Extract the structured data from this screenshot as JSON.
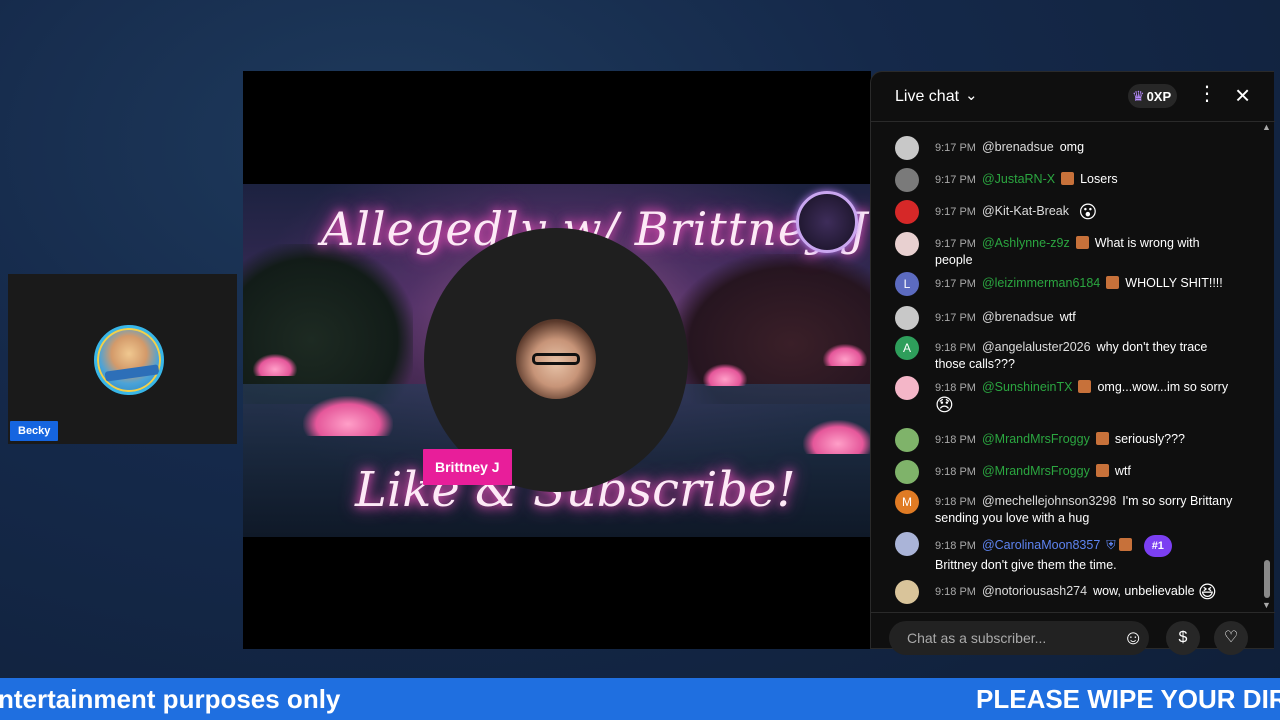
{
  "guest": {
    "name": "Becky"
  },
  "host": {
    "name": "Brittney J"
  },
  "banner": {
    "title": "Allegedly w/ Brittney J",
    "subtitle": "Like & Subscribe!"
  },
  "chat": {
    "title": "Live chat",
    "xp": "0XP",
    "input_placeholder": "Chat as a subscriber...",
    "messages": [
      {
        "time": "9:17 PM",
        "author": "@brenadsue",
        "text": "omg",
        "author_type": "normal",
        "avatar": "#c8c8c8"
      },
      {
        "time": "9:17 PM",
        "author": "@JustaRN-X",
        "text": "Losers",
        "author_type": "member",
        "avatar": "#7a7a7a"
      },
      {
        "time": "9:17 PM",
        "author": "@Kit-Kat-Break",
        "text": "",
        "author_type": "normal",
        "avatar": "#d62828",
        "emoji": "😮"
      },
      {
        "time": "9:17 PM",
        "author": "@Ashlynne-z9z",
        "text": "What is wrong with people",
        "author_type": "member",
        "avatar": "#e8d0d0"
      },
      {
        "time": "9:17 PM",
        "author": "@leizimmerman6184",
        "text": "WHOLLY SHIT!!!!",
        "author_type": "member",
        "avatar": "#5c6bc0",
        "initial": "L"
      },
      {
        "time": "9:17 PM",
        "author": "@brenadsue",
        "text": "wtf",
        "author_type": "normal",
        "avatar": "#c8c8c8"
      },
      {
        "time": "9:18 PM",
        "author": "@angelaluster2026",
        "text": "why don't they trace those calls???",
        "author_type": "normal",
        "avatar": "#2e9e5b",
        "initial": "A"
      },
      {
        "time": "9:18 PM",
        "author": "@SunshineinTX",
        "text": "omg...wow...im so sorry",
        "author_type": "member",
        "avatar": "#f4b6c8",
        "emoji": "😞"
      },
      {
        "time": "9:18 PM",
        "author": "@MrandMrsFroggy",
        "text": "seriously???",
        "author_type": "member",
        "avatar": "#7fb36a"
      },
      {
        "time": "9:18 PM",
        "author": "@MrandMrsFroggy",
        "text": "wtf",
        "author_type": "member",
        "avatar": "#7fb36a"
      },
      {
        "time": "9:18 PM",
        "author": "@mechellejohnson3298",
        "text": "I'm so sorry Brittany sending you love with a hug",
        "author_type": "normal",
        "avatar": "#e07b24",
        "initial": "M"
      },
      {
        "time": "9:18 PM",
        "author": "@CarolinaMoon8357",
        "text": "Brittney don't give them the time.",
        "author_type": "mod",
        "avatar": "#aab4d8",
        "rank": "#1"
      },
      {
        "time": "9:18 PM",
        "author": "@notoriousash274",
        "text": "wow, unbelievable",
        "author_type": "normal",
        "avatar": "#d9c49a",
        "emoji": "😆"
      }
    ]
  },
  "ticker": {
    "left": "ntertainment purposes only",
    "right": "PLEASE WIPE YOUR DIRT"
  },
  "colors": {
    "ticker_bg": "#1f6fe0",
    "host_tag": "#e81e9a",
    "member_name": "#2ba640",
    "mod_name": "#5e84f1"
  }
}
